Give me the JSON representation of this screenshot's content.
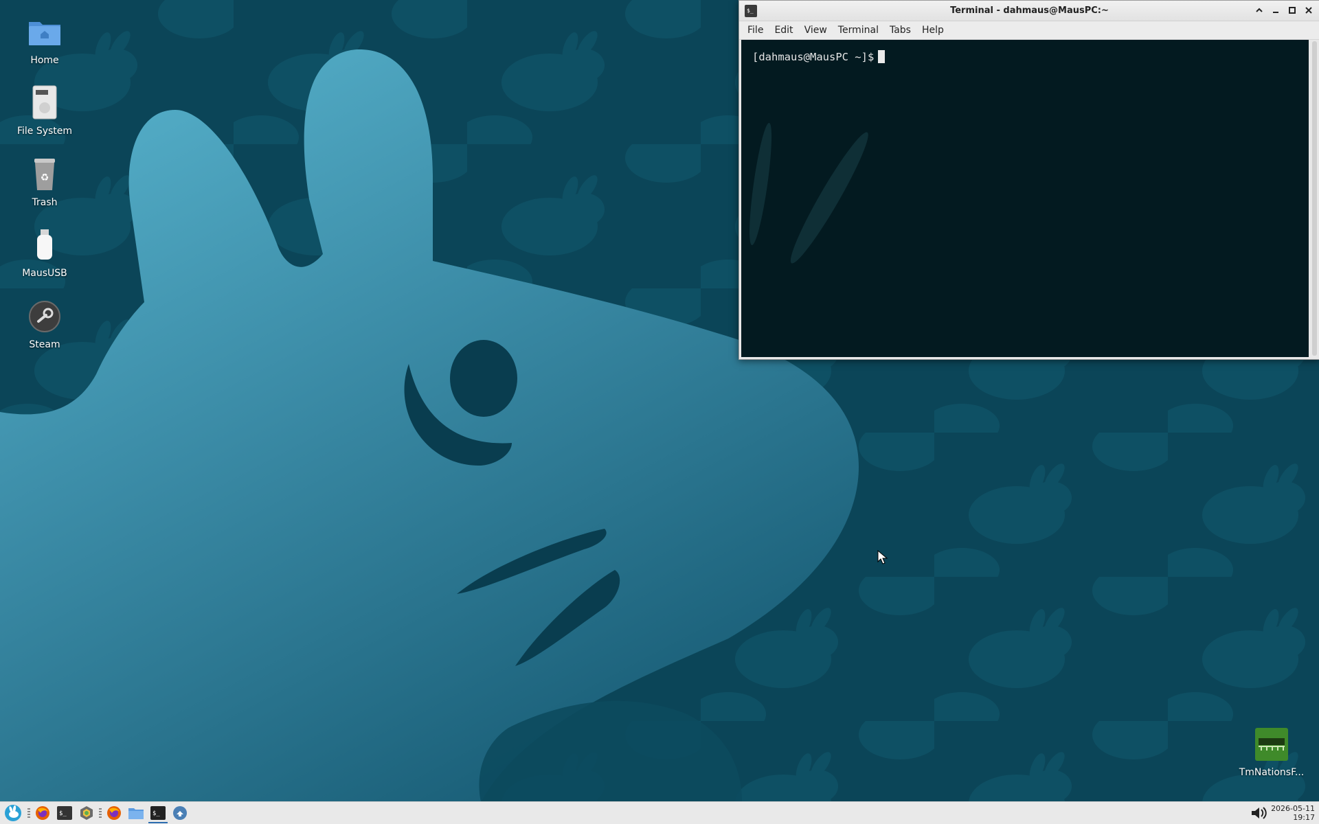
{
  "desktop": {
    "icons": [
      {
        "label": "Home",
        "icon": "home-folder-icon"
      },
      {
        "label": "File System",
        "icon": "drive-icon"
      },
      {
        "label": "Trash",
        "icon": "trash-icon"
      },
      {
        "label": "MausUSB",
        "icon": "usb-drive-icon"
      },
      {
        "label": "Steam",
        "icon": "steam-icon"
      }
    ],
    "right_icon": {
      "label": "TmNationsF...",
      "icon": "tmnations-game-icon"
    }
  },
  "terminal": {
    "title": "Terminal - dahmaus@MausPC:~",
    "menu": [
      "File",
      "Edit",
      "View",
      "Terminal",
      "Tabs",
      "Help"
    ],
    "prompt": "[dahmaus@MausPC ~]$"
  },
  "taskbar": {
    "apps": [
      "start-menu-icon",
      "firefox-icon",
      "terminal-icon",
      "settings-icon",
      "firefox-icon",
      "file-manager-icon",
      "terminal-icon",
      "screenshot-icon"
    ],
    "date": "2026-05-11",
    "time": "19:17"
  },
  "colors": {
    "desktop_bg": "#0b4558",
    "mascot": "#3f95b0",
    "terminal_bg": "#031a20",
    "taskbar_bg": "#e9e9e9"
  }
}
